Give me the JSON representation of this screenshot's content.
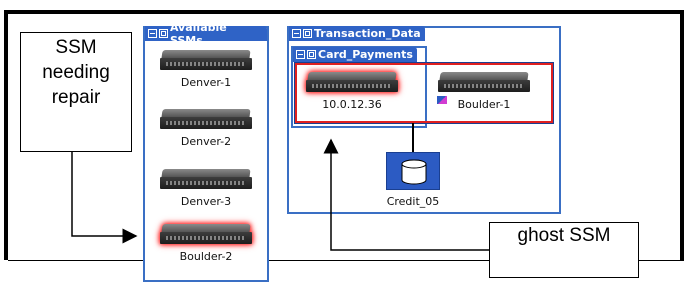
{
  "available_panel": {
    "title": "Available SSMs",
    "devices": [
      {
        "label": "Denver-1",
        "highlight": false
      },
      {
        "label": "Denver-2",
        "highlight": false
      },
      {
        "label": "Denver-3",
        "highlight": false
      },
      {
        "label": "Boulder-2",
        "highlight": true
      }
    ]
  },
  "transaction_panel": {
    "title": "Transaction_Data",
    "card_payments": {
      "title": "Card_Payments",
      "devices": [
        {
          "label": "10.0.12.36",
          "highlight": true
        },
        {
          "label": "Boulder-1",
          "highlight": false
        }
      ]
    },
    "database": {
      "label": "Credit_05"
    }
  },
  "annotations": {
    "repair_note": [
      "SSM",
      "needing",
      "repair"
    ],
    "ghost_note": "ghost SSM"
  },
  "colors": {
    "panel_blue": "#2f63c6",
    "alert_red": "#e02020",
    "db_blue": "#2c5bc3"
  }
}
